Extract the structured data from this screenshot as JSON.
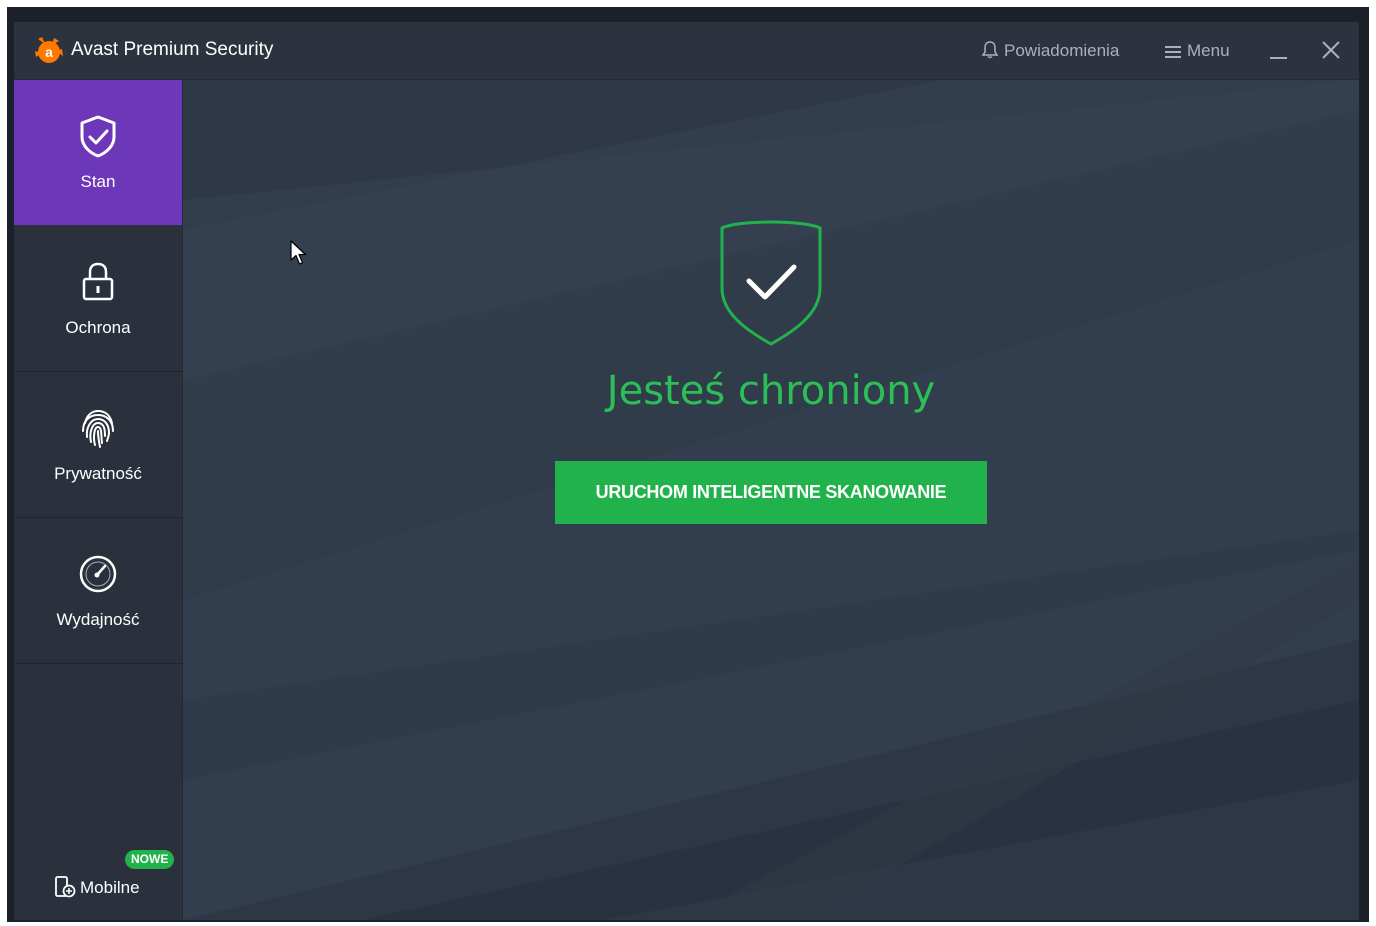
{
  "window": {
    "title": "Avast Premium Security",
    "notifications_label": "Powiadomienia",
    "menu_label": "Menu"
  },
  "sidebar": {
    "items": [
      {
        "label": "Stan",
        "icon": "shield-check-icon",
        "active": true
      },
      {
        "label": "Ochrona",
        "icon": "lock-icon",
        "active": false
      },
      {
        "label": "Prywatność",
        "icon": "fingerprint-icon",
        "active": false
      },
      {
        "label": "Wydajność",
        "icon": "speedometer-icon",
        "active": false
      }
    ],
    "mobile": {
      "label": "Mobilne",
      "badge": "NOWE",
      "icon": "mobile-add-icon"
    }
  },
  "main": {
    "status_text": "Jesteś chroniony",
    "scan_button_label": "URUCHOM INTELIGENTNE SKANOWANIE"
  },
  "colors": {
    "accent_purple": "#6c37b8",
    "accent_green": "#22b24c",
    "status_green": "#2dbf57",
    "background": "#2b323d"
  }
}
